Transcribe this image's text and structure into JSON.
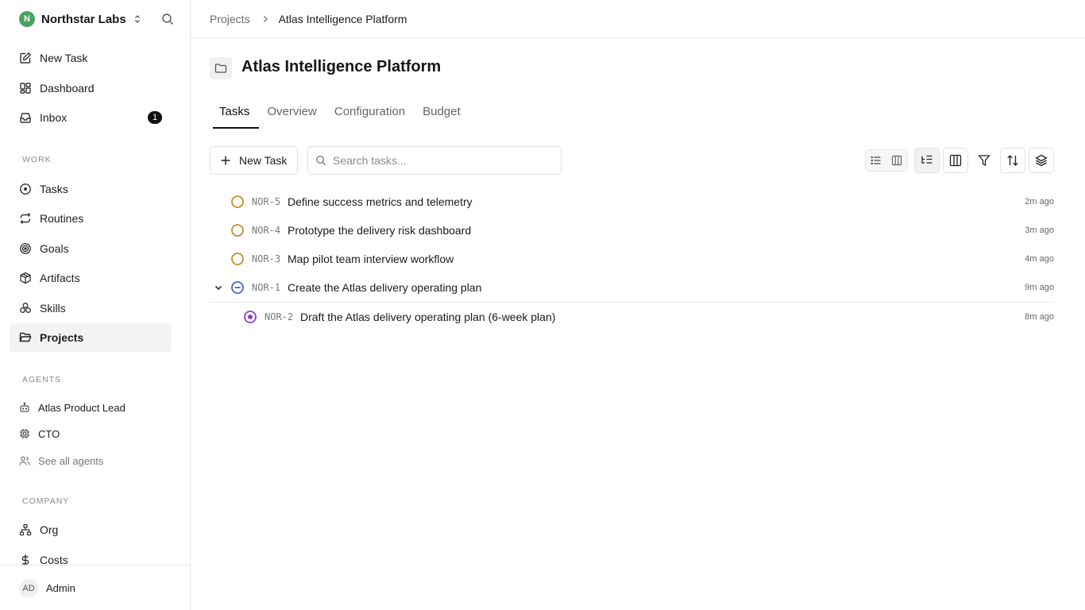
{
  "workspace": {
    "name": "Northstar Labs",
    "logo_letter": "N"
  },
  "sidebar": {
    "nav": [
      {
        "label": "New Task",
        "icon": "edit-icon"
      },
      {
        "label": "Dashboard",
        "icon": "dashboard-icon"
      },
      {
        "label": "Inbox",
        "icon": "inbox-icon",
        "badge": "1"
      }
    ],
    "work_heading": "WORK",
    "work_items": [
      {
        "label": "Tasks",
        "icon": "circle-dot-icon"
      },
      {
        "label": "Routines",
        "icon": "repeat-icon"
      },
      {
        "label": "Goals",
        "icon": "target-icon"
      },
      {
        "label": "Artifacts",
        "icon": "box-icon"
      },
      {
        "label": "Skills",
        "icon": "skills-icon"
      },
      {
        "label": "Projects",
        "icon": "folder-open-icon",
        "active": true
      }
    ],
    "agents_heading": "AGENTS",
    "agents": [
      {
        "label": "Atlas Product Lead",
        "icon": "bot-icon"
      },
      {
        "label": "CTO",
        "icon": "cpu-icon"
      },
      {
        "label": "See all agents",
        "icon": "users-icon"
      }
    ],
    "company_heading": "COMPANY",
    "company_items": [
      {
        "label": "Org",
        "icon": "org-chart-icon"
      },
      {
        "label": "Costs",
        "icon": "dollar-icon"
      }
    ],
    "user": {
      "initials": "AD",
      "name": "Admin"
    }
  },
  "breadcrumb": {
    "parent": "Projects",
    "current": "Atlas Intelligence Platform"
  },
  "project": {
    "title": "Atlas Intelligence Platform"
  },
  "tabs": [
    {
      "label": "Tasks",
      "active": true
    },
    {
      "label": "Overview"
    },
    {
      "label": "Configuration"
    },
    {
      "label": "Budget"
    }
  ],
  "toolbar": {
    "new_task_label": "New Task",
    "search_placeholder": "Search tasks...",
    "icons": [
      "list-view-icon",
      "board-view-icon",
      "tree-view-icon",
      "columns-icon",
      "filter-icon",
      "sort-icon",
      "layers-icon"
    ]
  },
  "tasks": [
    {
      "id": "NOR-5",
      "title": "Define success metrics and telemetry",
      "time": "2m ago",
      "status": "todo"
    },
    {
      "id": "NOR-4",
      "title": "Prototype the delivery risk dashboard",
      "time": "3m ago",
      "status": "todo"
    },
    {
      "id": "NOR-3",
      "title": "Map pilot team interview workflow",
      "time": "4m ago",
      "status": "todo"
    },
    {
      "id": "NOR-1",
      "title": "Create the Atlas delivery operating plan",
      "time": "9m ago",
      "status": "blocked",
      "expanded": true
    },
    {
      "id": "NOR-2",
      "title": "Draft the Atlas delivery operating plan (6-week plan)",
      "time": "8m ago",
      "status": "in-review",
      "child": true
    }
  ],
  "colors": {
    "todo": "#c98a2b",
    "blocked": "#4b63c9",
    "in_review": "#8a3fc7",
    "accent": "#111111"
  }
}
